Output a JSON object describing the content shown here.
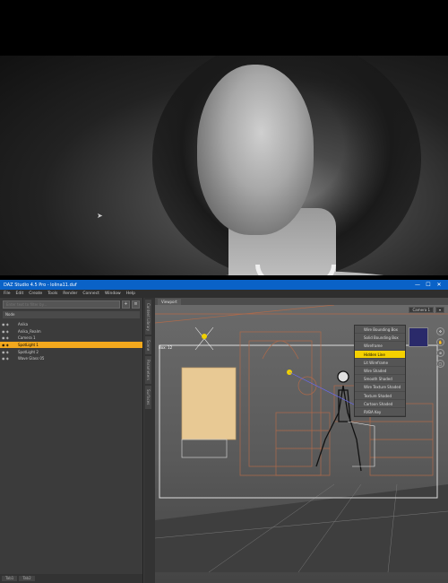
{
  "render": {
    "cursor": "➤"
  },
  "window": {
    "title": "DAZ Studio 4.5 Pro - lolina11.duf",
    "minimize": "—",
    "maximize": "☐",
    "close": "✕"
  },
  "menu": {
    "items": [
      "File",
      "Edit",
      "Create",
      "Tools",
      "Render",
      "Connect",
      "Window",
      "Help"
    ]
  },
  "scene": {
    "search_placeholder": "Enter text to filter by...",
    "header": "Node",
    "items": [
      {
        "label": "Anika"
      },
      {
        "label": "Anika_Realm"
      },
      {
        "label": "Camera 1"
      },
      {
        "label": "SpotLight 1"
      },
      {
        "label": "SpotLight 2"
      },
      {
        "label": "Wave Glass 05"
      }
    ],
    "footer_tabs": [
      "Tab1",
      "Tab2"
    ]
  },
  "side_tabs": [
    "Content Library",
    "Scene",
    "Parameters",
    "Surfaces"
  ],
  "viewport": {
    "tab": "Viewport",
    "camera_select": "Camera 1",
    "frame_label": "Box: 12",
    "draw_styles": [
      "Wire Bounding Box",
      "Solid Bounding Box",
      "Wireframe",
      "Hidden Line",
      "Lit Wireframe",
      "Wire Shaded",
      "Smooth Shaded",
      "Wire Texture Shaded",
      "Texture Shaded",
      "Cartoon Shaded",
      "RVBA Key"
    ],
    "selected_style": "Hidden Line"
  },
  "colors": {
    "titlebar": "#0a62c7",
    "selection": "#f2a81d",
    "dropdown_highlight": "#f5d100"
  }
}
